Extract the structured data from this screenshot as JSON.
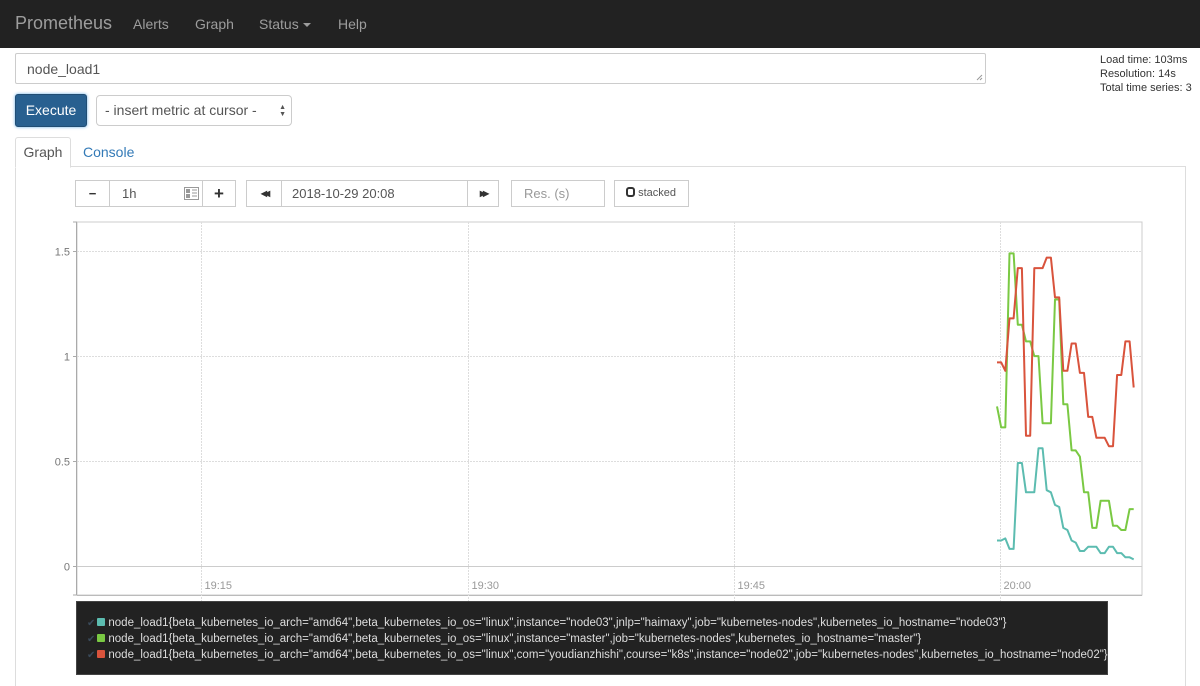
{
  "navbar": {
    "brand": "Prometheus",
    "items": [
      "Alerts",
      "Graph",
      "Status",
      "Help"
    ]
  },
  "expression": {
    "value": "node_load1"
  },
  "stats": {
    "load_time": "Load time: 103ms",
    "resolution": "Resolution: 14s",
    "total_series": "Total time series: 3"
  },
  "toolbar": {
    "execute_label": "Execute",
    "metric_select": "- insert metric at cursor -"
  },
  "tabs": [
    {
      "label": "Graph",
      "active": true
    },
    {
      "label": "Console",
      "active": false
    }
  ],
  "graph_controls": {
    "minus_label": "−",
    "range": "1h",
    "plus_label": "+",
    "back_label": "◀◀",
    "end_time": "2018-10-29 20:08",
    "forward_label": "▶▶",
    "resolution_placeholder": "Res. (s)",
    "stacked_label": "stacked"
  },
  "chart_data": {
    "type": "line",
    "title": "",
    "xlabel": "",
    "ylabel": "",
    "x_ticks": [
      "19:15",
      "19:30",
      "19:45",
      "20:00"
    ],
    "x_range": [
      "19:08",
      "20:08"
    ],
    "y_ticks": [
      0,
      0.5,
      1,
      1.5
    ],
    "ylim": [
      -0.14,
      1.64
    ],
    "grid": true,
    "step_seconds": 14,
    "start_time": "19:59:50",
    "series": [
      {
        "name": "node_load1{beta_kubernetes_io_arch=\"amd64\",beta_kubernetes_io_os=\"linux\",instance=\"node03\",jnlp=\"haimaxy\",job=\"kubernetes-nodes\",kubernetes_io_hostname=\"node03\"}",
        "color": "#5cbcb0",
        "values": [
          0.12,
          0.12,
          0.13,
          0.08,
          0.08,
          0.49,
          0.49,
          0.35,
          0.35,
          0.35,
          0.56,
          0.56,
          0.36,
          0.35,
          0.29,
          0.28,
          0.18,
          0.17,
          0.12,
          0.11,
          0.07,
          0.07,
          0.09,
          0.09,
          0.09,
          0.06,
          0.06,
          0.09,
          0.09,
          0.06,
          0.06,
          0.04,
          0.04,
          0.03
        ]
      },
      {
        "name": "node_load1{beta_kubernetes_io_arch=\"amd64\",beta_kubernetes_io_os=\"linux\",instance=\"master\",job=\"kubernetes-nodes\",kubernetes_io_hostname=\"master\"}",
        "color": "#7ac943",
        "values": [
          0.76,
          0.66,
          0.66,
          1.49,
          1.49,
          1.15,
          1.15,
          1.07,
          1.07,
          1.0,
          1.0,
          0.68,
          0.68,
          0.68,
          1.27,
          1.27,
          0.77,
          0.77,
          0.55,
          0.55,
          0.52,
          0.35,
          0.35,
          0.18,
          0.18,
          0.31,
          0.31,
          0.31,
          0.19,
          0.19,
          0.17,
          0.17,
          0.27,
          0.27
        ]
      },
      {
        "name": "node_load1{beta_kubernetes_io_arch=\"amd64\",beta_kubernetes_io_os=\"linux\",com=\"youdianzhishi\",course=\"k8s\",instance=\"node02\",job=\"kubernetes-nodes\",kubernetes_io_hostname=\"node02\"}",
        "color": "#d9533c",
        "values": [
          0.97,
          0.97,
          0.93,
          1.18,
          1.18,
          1.42,
          1.42,
          0.62,
          0.62,
          1.42,
          1.42,
          1.42,
          1.47,
          1.47,
          1.28,
          1.28,
          0.93,
          0.93,
          1.06,
          1.06,
          0.92,
          0.92,
          0.71,
          0.71,
          0.61,
          0.61,
          0.61,
          0.57,
          0.57,
          0.91,
          0.91,
          1.07,
          1.07,
          0.85
        ]
      }
    ]
  }
}
